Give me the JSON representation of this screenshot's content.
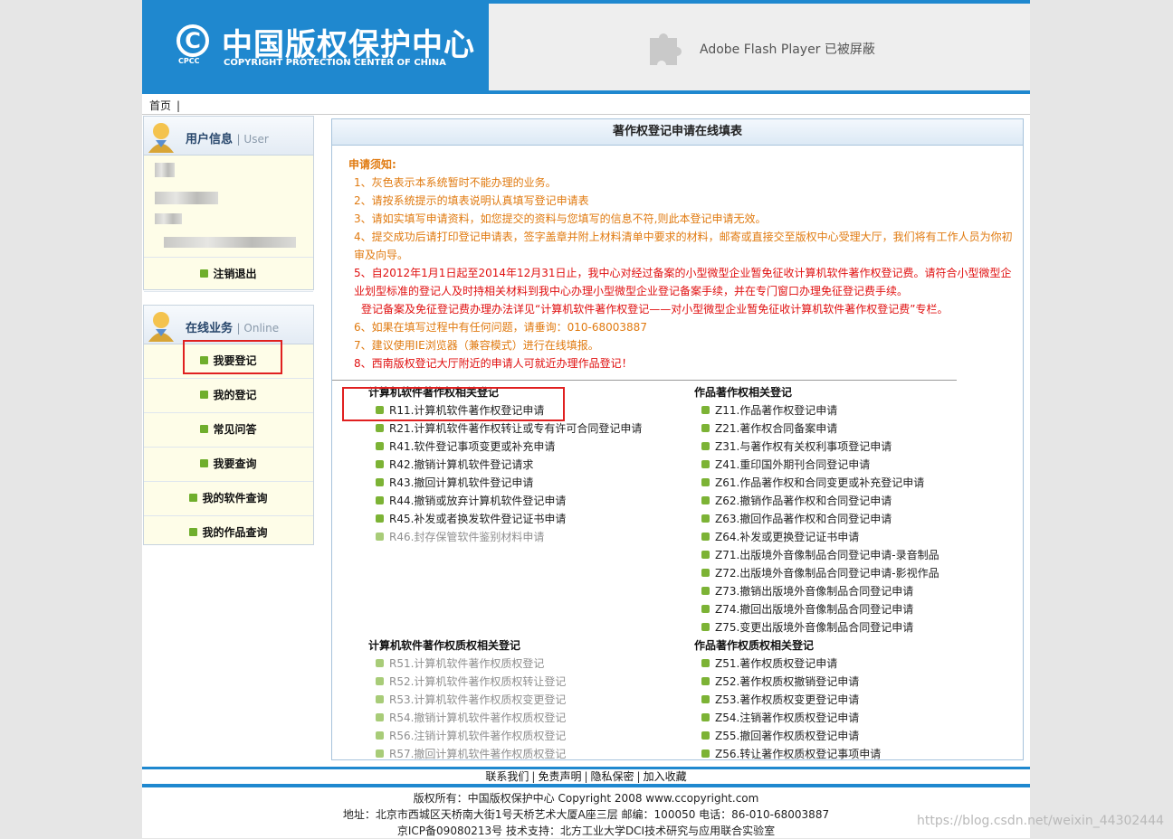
{
  "header": {
    "logo_symbol": "C",
    "logo_cpcc": "CPCC",
    "logo_cn": "中国版权保护中心",
    "logo_en": "COPYRIGHT PROTECTION CENTER OF CHINA",
    "flash_text": "Adobe Flash Player 已被屏蔽"
  },
  "breadcrumb": {
    "home": "首页",
    "sep": "|"
  },
  "user_panel": {
    "title": "用户信息",
    "subtitle": "| User",
    "logout": "注销退出"
  },
  "online_panel": {
    "title": "在线业务",
    "subtitle": "| Online",
    "items": [
      {
        "label": "我要登记"
      },
      {
        "label": "我的登记"
      },
      {
        "label": "常见问答"
      },
      {
        "label": "我要查询"
      },
      {
        "label": "我的软件查询"
      },
      {
        "label": "我的作品查询"
      }
    ]
  },
  "main": {
    "title": "著作权登记申请在线填表",
    "notes_head": "申请须知:",
    "notes": [
      "1、灰色表示本系统暂时不能办理的业务。",
      "2、请按系统提示的填表说明认真填写登记申请表",
      "3、请如实填写申请资料，如您提交的资料与您填写的信息不符,则此本登记申请无效。",
      "4、提交成功后请打印登记申请表，签字盖章并附上材料清单中要求的材料，邮寄或直接交至版权中心受理大厅，我们将有工作人员为你初审及向导。",
      "5、自2012年1月1日起至2014年12月31日止，我中心对经过备案的小型微型企业暂免征收计算机软件著作权登记费。请符合小型微型企业划型标准的登记人及时持相关材料到我中心办理小型微型企业登记备案手续，并在专门窗口办理免征登记费手续。",
      "登记备案及免征登记费办理办法详见“计算机软件著作权登记——对小型微型企业暂免征收计算机软件著作权登记费”专栏。",
      "6、如果在填写过程中有任何问题，请垂询：010-68003887",
      "7、建议使用IE浏览器（兼容模式）进行在线填报。",
      "8、西南版权登记大厅附近的申请人可就近办理作品登记！"
    ],
    "software_title": "计算机软件著作权相关登记",
    "software_items": [
      {
        "label": "R11.计算机软件著作权登记申请",
        "gray": false
      },
      {
        "label": "R21.计算机软件著作权转让或专有许可合同登记申请",
        "gray": false
      },
      {
        "label": "R41.软件登记事项变更或补充申请",
        "gray": false
      },
      {
        "label": "R42.撤销计算机软件登记请求",
        "gray": false
      },
      {
        "label": "R43.撤回计算机软件登记申请",
        "gray": false
      },
      {
        "label": "R44.撤销或放弃计算机软件登记申请",
        "gray": false
      },
      {
        "label": "R45.补发或者换发软件登记证书申请",
        "gray": false
      },
      {
        "label": "R46.封存保管软件鉴别材料申请",
        "gray": true
      }
    ],
    "works_title": "作品著作权相关登记",
    "works_items": [
      {
        "label": "Z11.作品著作权登记申请",
        "gray": false
      },
      {
        "label": "Z21.著作权合同备案申请",
        "gray": false
      },
      {
        "label": "Z31.与著作权有关权利事项登记申请",
        "gray": false
      },
      {
        "label": "Z41.重印国外期刊合同登记申请",
        "gray": false
      },
      {
        "label": "Z61.作品著作权和合同变更或补充登记申请",
        "gray": false
      },
      {
        "label": "Z62.撤销作品著作权和合同登记申请",
        "gray": false
      },
      {
        "label": "Z63.撤回作品著作权和合同登记申请",
        "gray": false
      },
      {
        "label": "Z64.补发或更换登记证书申请",
        "gray": false
      },
      {
        "label": "Z71.出版境外音像制品合同登记申请-录音制品",
        "gray": false
      },
      {
        "label": "Z72.出版境外音像制品合同登记申请-影视作品",
        "gray": false
      },
      {
        "label": "Z73.撤销出版境外音像制品合同登记申请",
        "gray": false
      },
      {
        "label": "Z74.撤回出版境外音像制品合同登记申请",
        "gray": false
      },
      {
        "label": "Z75.变更出版境外音像制品合同登记申请",
        "gray": false
      }
    ],
    "software_pledge_title": "计算机软件著作权质权相关登记",
    "software_pledge_items": [
      {
        "label": "R51.计算机软件著作权质权登记",
        "gray": true
      },
      {
        "label": "R52.计算机软件著作权质权转让登记",
        "gray": true
      },
      {
        "label": "R53.计算机软件著作权质权变更登记",
        "gray": true
      },
      {
        "label": "R54.撤销计算机软件著作权质权登记",
        "gray": true
      },
      {
        "label": "R56.注销计算机软件著作权质权登记",
        "gray": true
      },
      {
        "label": "R57.撤回计算机软件著作权质权登记",
        "gray": true
      }
    ],
    "works_pledge_title": "作品著作权质权相关登记",
    "works_pledge_items": [
      {
        "label": "Z51.著作权质权登记申请",
        "gray": false
      },
      {
        "label": "Z52.著作权质权撤销登记申请",
        "gray": false
      },
      {
        "label": "Z53.著作权质权变更登记申请",
        "gray": false
      },
      {
        "label": "Z54.注销著作权质权登记申请",
        "gray": false
      },
      {
        "label": "Z55.撤回著作权质权登记申请",
        "gray": false
      },
      {
        "label": "Z56.转让著作权质权登记事项申请",
        "gray": false
      }
    ]
  },
  "footer": {
    "links": [
      "联系我们",
      "免责声明",
      "隐私保密",
      "加入收藏"
    ],
    "copyright": "版权所有：中国版权保护中心 Copyright 2008 www.ccopyright.com",
    "address": "地址：北京市西城区天桥南大街1号天桥艺术大厦A座三层 邮编：100050 电话：86-010-68003887",
    "icp": "京ICP备09080213号 技术支持：北方工业大学DCI技术研究与应用联合实验室"
  },
  "watermark": "https://blog.csdn.net/weixin_44302444",
  "colors": {
    "brand_blue": "#1f88cf",
    "highlight_red": "#e02020",
    "note_orange": "#e07a10",
    "note_red": "#e01010"
  }
}
